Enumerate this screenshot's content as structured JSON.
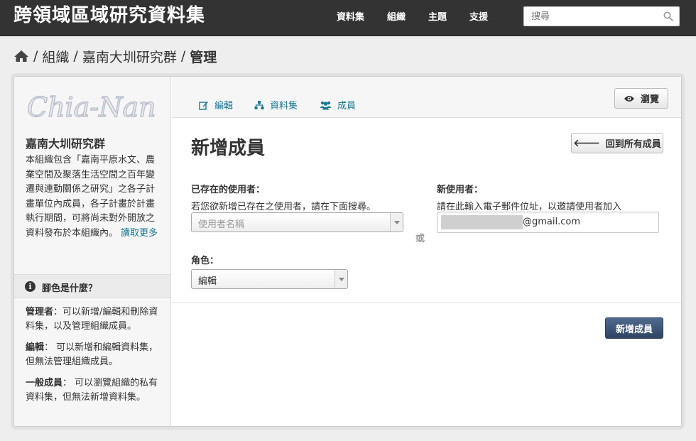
{
  "header": {
    "site_title": "跨領域區域研究資料集",
    "nav": [
      "資料集",
      "組織",
      "主題",
      "支援"
    ],
    "search_placeholder": "搜尋"
  },
  "breadcrumb": {
    "items": [
      "組織",
      "嘉南大圳研究群",
      "管理"
    ]
  },
  "sidebar": {
    "logo_text": "Chia-Nan",
    "org_name": "嘉南大圳研究群",
    "org_description": "本組織包含「嘉南平原水文、農業空間及聚落生活空間之百年變遷與連動關係之研究」之各子計畫單位內成員，各子計畫於計畫執行期間，可將尚未對外開放之資料發布於本組織內。",
    "read_more": "讀取更多",
    "roles_title": "腳色是什麼？",
    "roles": [
      {
        "name": "管理者",
        "sep": "：",
        "desc": "可以新增/編輯和刪除資料集，以及管理組織成員。"
      },
      {
        "name": "編輯",
        "sep": "： ",
        "desc": "可以新增和編輯資料集，但無法管理組織成員。"
      },
      {
        "name": "一般成員",
        "sep": "： ",
        "desc": "可以瀏覽組織的私有資料集，但無法新增資料集。"
      }
    ]
  },
  "main": {
    "tabs": [
      {
        "label": "編輯",
        "icon": "edit-icon"
      },
      {
        "label": "資料集",
        "icon": "sitemap-icon"
      },
      {
        "label": "成員",
        "icon": "users-icon"
      }
    ],
    "preview_label": "瀏覽",
    "heading": "新增成員",
    "back_label": "回到所有成員",
    "existing_user_label": "已存在的使用者：",
    "existing_user_help": "若您欲新增已存在之使用者，請在下面搜尋。",
    "username_placeholder": "使用者名稱",
    "or_text": "或",
    "new_user_label": "新使用者：",
    "new_user_help": "請在此輸入電子郵件位址，以邀請使用者加入",
    "email_domain": "@gmail.com",
    "role_label": "角色：",
    "role_value": "編輯",
    "submit_label": "新增成員"
  },
  "colors": {
    "header_bg": "#333333",
    "link": "#187794",
    "primary_button": "#2e4563"
  }
}
